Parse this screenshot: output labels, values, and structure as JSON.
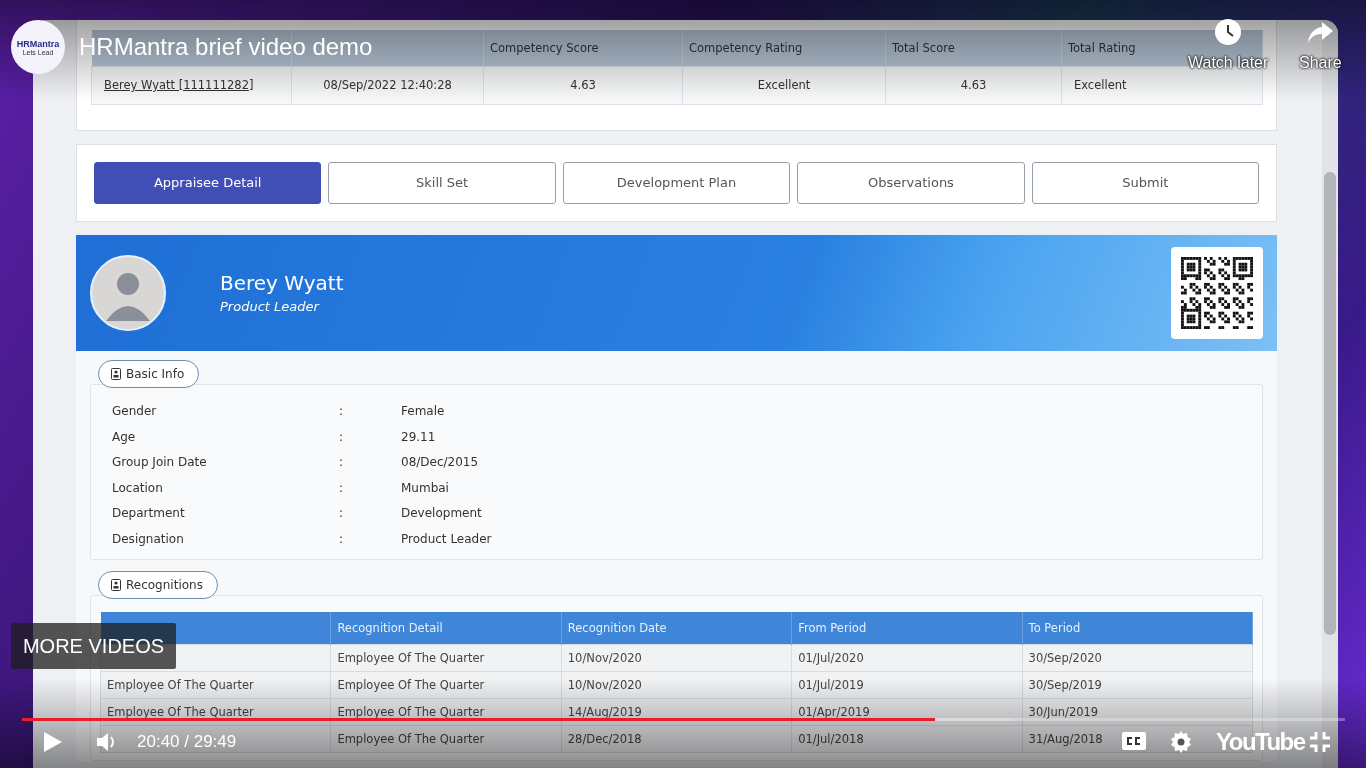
{
  "player": {
    "title": "HRMantra brief video demo",
    "channel": {
      "name": "HRMantra",
      "tagline": "Lets Lead"
    },
    "actions": [
      {
        "kind": "clock",
        "label": "Watch later"
      },
      {
        "kind": "share",
        "label": "Share"
      }
    ],
    "more_videos": "MORE VIDEOS",
    "time": "20:40 / 29:49",
    "progress": {
      "level": 0.69
    },
    "buffered": {
      "level": 0.75
    },
    "logo": "YouTube"
  },
  "summary_table": {
    "columns": [
      {},
      {},
      {
        "label": "Competency Score"
      },
      {
        "label": "Competency Rating"
      },
      {
        "label": "Total Score"
      },
      {
        "label": "Total Rating"
      }
    ],
    "rows": [
      [
        "Berey Wyatt [111111282]",
        "08/Sep/2022 12:40:28",
        "4.63",
        "Excellent",
        "4.63",
        "Excellent"
      ]
    ]
  },
  "tabs": [
    {
      "label": "Appraisee Detail",
      "selected": true
    },
    {
      "label": "Skill Set",
      "selected": false
    },
    {
      "label": "Development Plan",
      "selected": false
    },
    {
      "label": "Observations",
      "selected": false
    },
    {
      "label": "Submit",
      "selected": false
    }
  ],
  "profile": {
    "name": "Berey Wyatt",
    "role": "Product Leader"
  },
  "basic_info": {
    "legend": "Basic Info",
    "rows": [
      {
        "label": "Gender",
        "sep": ":",
        "value": "Female"
      },
      {
        "label": "Age",
        "sep": ":",
        "value": "29.11"
      },
      {
        "label": "Group Join Date",
        "sep": ":",
        "value": "08/Dec/2015"
      },
      {
        "label": "Location",
        "sep": ":",
        "value": "Mumbai"
      },
      {
        "label": "Department",
        "sep": ":",
        "value": "Development"
      },
      {
        "label": "Designation",
        "sep": ":",
        "value": "Product Leader"
      }
    ]
  },
  "recognitions": {
    "legend": "Recognitions",
    "columns": [
      null,
      "Recognition Detail",
      "Recognition Date",
      "From Period",
      "To Period"
    ],
    "rows": [
      [
        null,
        "Employee Of The Quarter",
        "10/Nov/2020",
        "01/Jul/2020",
        "30/Sep/2020"
      ],
      [
        "Employee Of The Quarter",
        "Employee Of The Quarter",
        "10/Nov/2020",
        "01/Jul/2019",
        "30/Sep/2019"
      ],
      [
        "Employee Of The Quarter",
        "Employee Of The Quarter",
        "14/Aug/2019",
        "01/Apr/2019",
        "30/Jun/2019"
      ],
      [
        null,
        "Employee Of The Quarter",
        "28/Dec/2018",
        "01/Jul/2018",
        "31/Aug/2018"
      ]
    ]
  }
}
